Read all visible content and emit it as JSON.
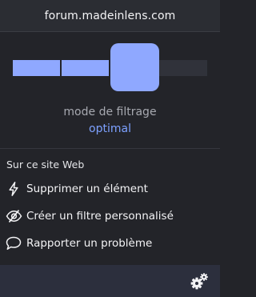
{
  "header": {
    "site": "forum.madeinlens.com"
  },
  "filter": {
    "label": "mode de filtrage",
    "value": "optimal",
    "level_index": 2,
    "level_count": 4,
    "colors": {
      "active": "#8fa8ff",
      "inactive": "#30323a",
      "value": "#7da1ff"
    }
  },
  "site_section": {
    "title": "Sur ce site Web",
    "actions": [
      {
        "label": "Supprimer un élément",
        "icon": "lightning-bolt-icon"
      },
      {
        "label": "Créer un filtre personnalisé",
        "icon": "eye-slash-icon"
      },
      {
        "label": "Rapporter un problème",
        "icon": "speech-bubble-icon"
      }
    ]
  },
  "footer": {
    "icon": "settings-gears-icon"
  }
}
